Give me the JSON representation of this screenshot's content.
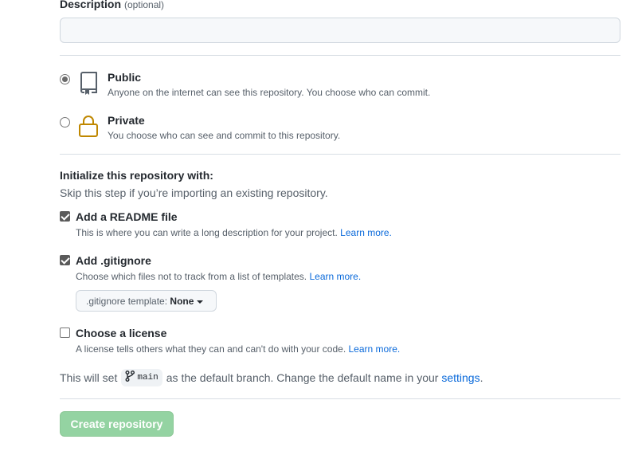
{
  "description": {
    "label": "Description",
    "optional": "(optional)",
    "value": ""
  },
  "visibility": {
    "public": {
      "title": "Public",
      "subtitle": "Anyone on the internet can see this repository. You choose who can commit.",
      "checked": true
    },
    "private": {
      "title": "Private",
      "subtitle": "You choose who can see and commit to this repository.",
      "checked": false
    }
  },
  "init": {
    "title": "Initialize this repository with:",
    "subtitle": "Skip this step if you’re importing an existing repository.",
    "readme": {
      "label": "Add a README file",
      "desc": "This is where you can write a long description for your project.",
      "link": "Learn more.",
      "checked": true
    },
    "gitignore": {
      "label": "Add .gitignore",
      "desc": "Choose which files not to track from a list of templates.",
      "link": "Learn more.",
      "checked": true,
      "template_label": ".gitignore template:",
      "template_value": "None"
    },
    "license": {
      "label": "Choose a license",
      "desc": "A license tells others what they can and can't do with your code.",
      "link": "Learn more.",
      "checked": false
    }
  },
  "branch": {
    "prefix": "This will set",
    "name": "main",
    "middle": "as the default branch. Change the default name in your",
    "link": "settings",
    "suffix": "."
  },
  "submit": {
    "label": "Create repository"
  },
  "colors": {
    "link": "#0969da",
    "button_disabled": "#94d3a2",
    "lock_icon": "#bf8700"
  },
  "icons": {
    "public": "repo-icon",
    "private": "lock-icon",
    "branch": "git-branch-icon"
  }
}
